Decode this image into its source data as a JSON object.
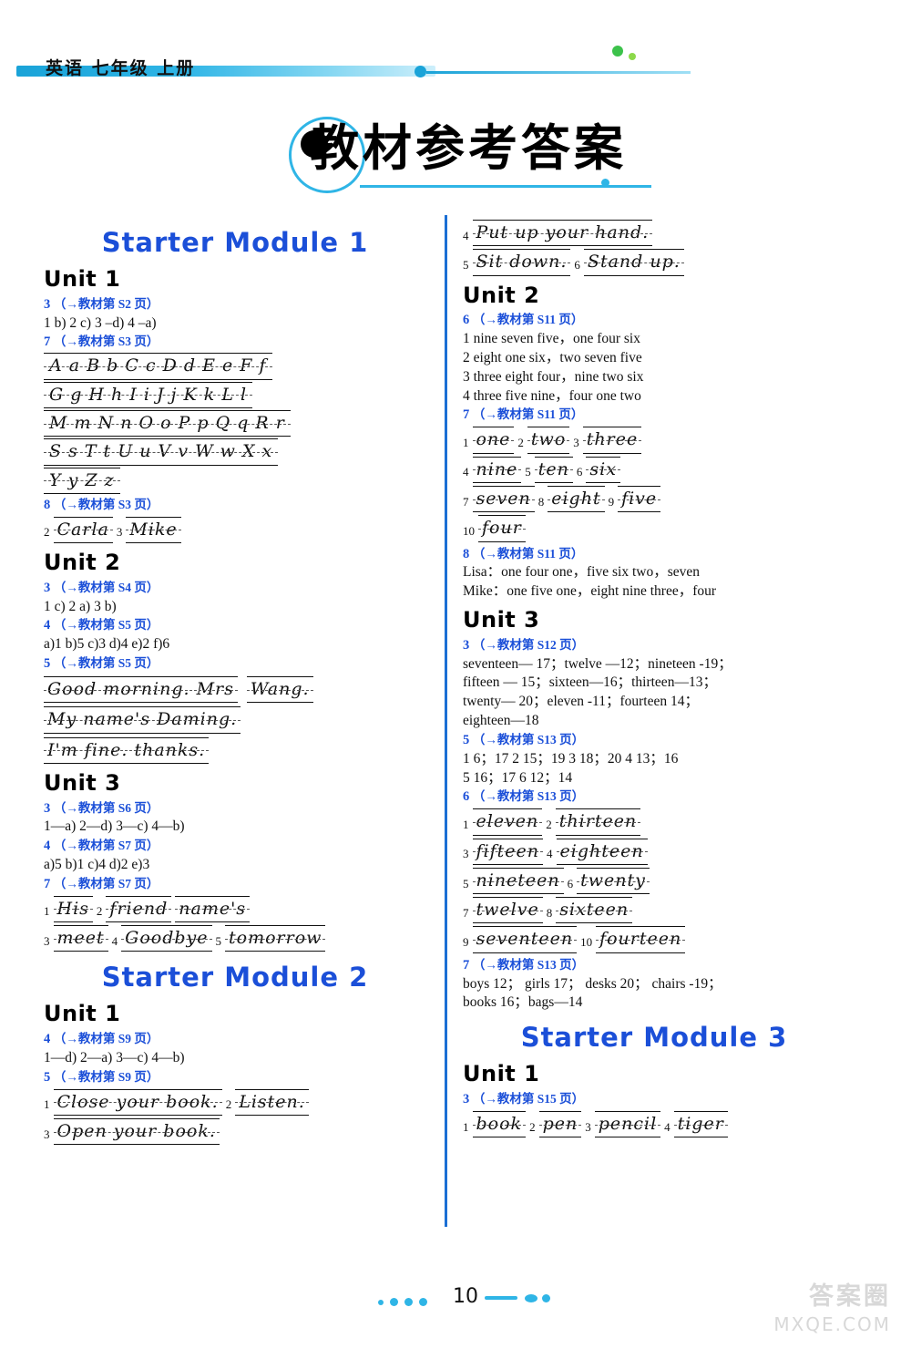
{
  "header": {
    "title": "英语 七年级 上册"
  },
  "page_title": "教材参考答案",
  "footer": {
    "page_number": "10",
    "watermark_cn": "答案圈",
    "watermark_en": "MXQE.COM"
  },
  "left_column": {
    "modules": [
      {
        "title": "Starter  Module 1",
        "units": [
          {
            "title": "Unit 1",
            "blocks": [
              {
                "type": "ref",
                "num": "3",
                "ref": "（→教材第 S2 页）"
              },
              {
                "type": "text",
                "lines": [
                  "1  b)   2  c)   3 –d)   4 –a)"
                ]
              },
              {
                "type": "ref",
                "num": "7",
                "ref": "（→教材第 S3 页）"
              },
              {
                "type": "alphabet",
                "rows": [
                  "A a  B b  C c  D d  E e  F f",
                  "G g  H h  I i  J j  K k  L l",
                  "M m  N n  O o  P p  Q q  R r",
                  "S s  T t  U u  V v  W w  X x",
                  "Y y  Z z"
                ]
              },
              {
                "type": "ref",
                "num": "8",
                "ref": "（→教材第 S3 页）"
              },
              {
                "type": "hand_items",
                "items": [
                  {
                    "num": "2",
                    "text": "Carla"
                  },
                  {
                    "num": "3",
                    "text": "Mike"
                  }
                ]
              }
            ]
          },
          {
            "title": "Unit 2",
            "blocks": [
              {
                "type": "ref",
                "num": "3",
                "ref": "（→教材第 S4 页）"
              },
              {
                "type": "text",
                "lines": [
                  "1  c)   2  a)   3  b)"
                ]
              },
              {
                "type": "ref",
                "num": "4",
                "ref": "（→教材第 S5 页）"
              },
              {
                "type": "text",
                "lines": [
                  "a)1   b)5   c)3   d)4   e)2   f)6"
                ]
              },
              {
                "type": "ref",
                "num": "5",
                "ref": "（→教材第 S5 页）"
              },
              {
                "type": "hand_lines",
                "lines": [
                  [
                    "Good  morning.  Mrs",
                    "Wang."
                  ],
                  [
                    "My  name's  Daming."
                  ],
                  [
                    "I'm  fine.  thanks."
                  ]
                ]
              }
            ]
          },
          {
            "title": "Unit 3",
            "blocks": [
              {
                "type": "ref",
                "num": "3",
                "ref": "（→教材第 S6 页）"
              },
              {
                "type": "text",
                "lines": [
                  "1—a)   2—d)   3—c)   4—b)"
                ]
              },
              {
                "type": "ref",
                "num": "4",
                "ref": "（→教材第 S7 页）"
              },
              {
                "type": "text",
                "lines": [
                  "a)5   b)1   c)4   d)2   e)3"
                ]
              },
              {
                "type": "ref",
                "num": "7",
                "ref": "（→教材第 S7 页）"
              },
              {
                "type": "hand_items",
                "items": [
                  {
                    "num": "1",
                    "text": "His"
                  },
                  {
                    "num": "2",
                    "text": "friend"
                  },
                  {
                    "num": "",
                    "text": "name's"
                  }
                ]
              },
              {
                "type": "hand_items",
                "items": [
                  {
                    "num": "3",
                    "text": "meet"
                  },
                  {
                    "num": "4",
                    "text": "Goodbye"
                  },
                  {
                    "num": "5",
                    "text": "tomorrow"
                  }
                ]
              }
            ]
          }
        ]
      },
      {
        "title": "Starter  Module 2",
        "units": [
          {
            "title": "Unit 1",
            "blocks": [
              {
                "type": "ref",
                "num": "4",
                "ref": "（→教材第 S9 页）"
              },
              {
                "type": "text",
                "lines": [
                  "1—d)   2—a)   3—c)   4—b)"
                ]
              },
              {
                "type": "ref",
                "num": "5",
                "ref": "（→教材第 S9 页）"
              },
              {
                "type": "hand_items",
                "items": [
                  {
                    "num": "1",
                    "text": "Close  your  book."
                  },
                  {
                    "num": "2",
                    "text": "Listen."
                  }
                ]
              },
              {
                "type": "hand_items",
                "items": [
                  {
                    "num": "3",
                    "text": "Open  your  book."
                  }
                ]
              }
            ]
          }
        ]
      }
    ]
  },
  "right_column": {
    "top_continuation": [
      {
        "type": "hand_items",
        "items": [
          {
            "num": "4",
            "text": "Put  up  your  hand."
          }
        ]
      },
      {
        "type": "hand_items",
        "items": [
          {
            "num": "5",
            "text": "Sit  down."
          },
          {
            "num": "6",
            "text": "Stand  up."
          }
        ]
      }
    ],
    "modules": [
      {
        "title": "",
        "units": [
          {
            "title": "Unit 2",
            "blocks": [
              {
                "type": "ref",
                "num": "6",
                "ref": "（→教材第 S11 页）"
              },
              {
                "type": "text",
                "lines": [
                  "1 nine seven five，one four six",
                  "2 eight one six，two seven five",
                  "3 three eight four，nine two six",
                  "4 three five nine，four one two"
                ]
              },
              {
                "type": "ref",
                "num": "7",
                "ref": "（→教材第 S11 页）"
              },
              {
                "type": "hand_items",
                "items": [
                  {
                    "num": "1",
                    "text": "one"
                  },
                  {
                    "num": "2",
                    "text": "two"
                  },
                  {
                    "num": "3",
                    "text": "three"
                  }
                ]
              },
              {
                "type": "hand_items",
                "items": [
                  {
                    "num": "4",
                    "text": "nine"
                  },
                  {
                    "num": "5",
                    "text": "ten"
                  },
                  {
                    "num": "6",
                    "text": "six"
                  }
                ]
              },
              {
                "type": "hand_items",
                "items": [
                  {
                    "num": "7",
                    "text": "seven"
                  },
                  {
                    "num": "8",
                    "text": "eight"
                  },
                  {
                    "num": "9",
                    "text": "five"
                  }
                ]
              },
              {
                "type": "hand_items",
                "items": [
                  {
                    "num": "10",
                    "text": "four"
                  }
                ]
              },
              {
                "type": "ref",
                "num": "8",
                "ref": "（→教材第 S11 页）"
              },
              {
                "type": "text",
                "lines": [
                  "Lisa：one four one，five six two，seven",
                  "Mike：one five one，eight nine three，four"
                ]
              }
            ]
          },
          {
            "title": "Unit 3",
            "blocks": [
              {
                "type": "ref",
                "num": "3",
                "ref": "（→教材第 S12 页）"
              },
              {
                "type": "text",
                "lines": [
                  "seventeen— 17；twelve —12；nineteen  -19；",
                  "fifteen — 15；sixteen—16；thirteen—13；",
                  "twenty— 20；eleven -11；fourteen  14；",
                  "eighteen—18"
                ]
              },
              {
                "type": "ref",
                "num": "5",
                "ref": "（→教材第 S13 页）"
              },
              {
                "type": "text",
                "lines": [
                  "1 6；17   2 15；19   3 18；20   4 13；16",
                  "5 16；17   6 12；14"
                ]
              },
              {
                "type": "ref",
                "num": "6",
                "ref": "（→教材第 S13 页）"
              },
              {
                "type": "hand_items",
                "items": [
                  {
                    "num": "1",
                    "text": "eleven"
                  },
                  {
                    "num": "2",
                    "text": "thirteen"
                  }
                ]
              },
              {
                "type": "hand_items",
                "items": [
                  {
                    "num": "3",
                    "text": "fifteen"
                  },
                  {
                    "num": "4",
                    "text": "eighteen"
                  }
                ]
              },
              {
                "type": "hand_items",
                "items": [
                  {
                    "num": "5",
                    "text": "nineteen"
                  },
                  {
                    "num": "6",
                    "text": "twenty"
                  }
                ]
              },
              {
                "type": "hand_items",
                "items": [
                  {
                    "num": "7",
                    "text": "twelve"
                  },
                  {
                    "num": "8",
                    "text": "sixteen"
                  }
                ]
              },
              {
                "type": "hand_items",
                "items": [
                  {
                    "num": "9",
                    "text": "seventeen"
                  },
                  {
                    "num": "10",
                    "text": "fourteen"
                  }
                ]
              },
              {
                "type": "ref",
                "num": "7",
                "ref": "（→教材第 S13 页）"
              },
              {
                "type": "text",
                "lines": [
                  "boys  12；  girls  17；  desks  20；  chairs  -19；",
                  "books   16；bags—14"
                ]
              }
            ]
          }
        ]
      },
      {
        "title": "Starter  Module 3",
        "units": [
          {
            "title": "Unit 1",
            "blocks": [
              {
                "type": "ref",
                "num": "3",
                "ref": "（→教材第 S15 页）"
              },
              {
                "type": "hand_items",
                "items": [
                  {
                    "num": "1",
                    "text": "book"
                  },
                  {
                    "num": "2",
                    "text": "pen"
                  },
                  {
                    "num": "3",
                    "text": "pencil"
                  },
                  {
                    "num": "4",
                    "text": "tiger"
                  }
                ]
              }
            ]
          }
        ]
      }
    ]
  }
}
